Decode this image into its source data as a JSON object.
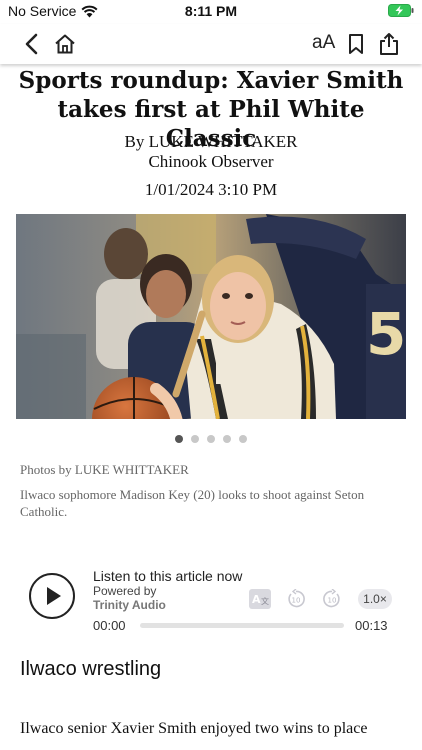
{
  "status_bar": {
    "carrier": "No Service",
    "time": "8:11 PM"
  },
  "toolbar": {
    "text_size_label": "aA"
  },
  "article": {
    "headline": "Sports roundup: Xavier Smith takes first at Phil White Classic",
    "byline": "By LUKE WHITTAKER",
    "source": "Chinook Observer",
    "date": "1/01/2024 3:10 PM",
    "photo_credit": "Photos by LUKE WHITTAKER",
    "caption": "Ilwaco sophomore Madison Key (20) looks to shoot against Seton Catholic.",
    "carousel": {
      "count": 5,
      "active_index": 0
    },
    "section_heading": "Ilwaco wrestling",
    "body_first_line": "Ilwaco senior Xavier Smith enjoyed two wins to place"
  },
  "audio_player": {
    "title": "Listen to this article now",
    "powered_by": "Powered by",
    "brand": "Trinity Audio",
    "speed": "1.0×",
    "current_time": "00:00",
    "duration": "00:13",
    "progress": 0,
    "rewind_label": "10",
    "forward_label": "10"
  },
  "colors": {
    "accent": "#222222",
    "caption": "#666666",
    "battery": "#33c759"
  }
}
